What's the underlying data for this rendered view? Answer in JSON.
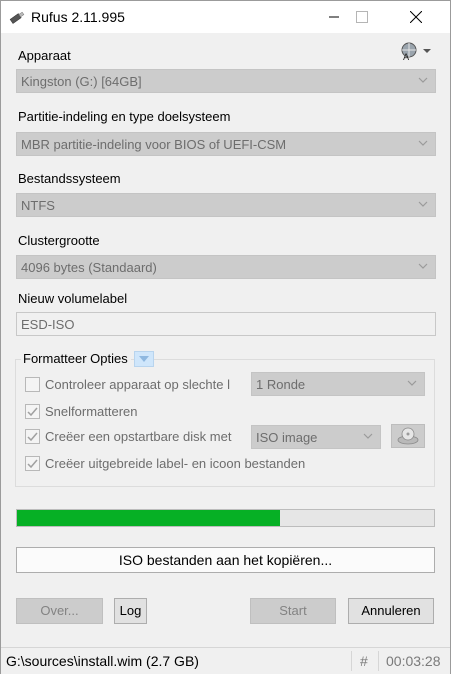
{
  "window": {
    "title": "Rufus 2.11.995"
  },
  "device": {
    "label": "Apparaat",
    "value": "Kingston (G:) [64GB]"
  },
  "partition": {
    "label": "Partitie-indeling en type doelsysteem",
    "value": "MBR partitie-indeling voor BIOS of UEFI-CSM"
  },
  "filesystem": {
    "label": "Bestandssysteem",
    "value": "NTFS"
  },
  "cluster": {
    "label": "Clustergrootte",
    "value": "4096 bytes (Standaard)"
  },
  "volume": {
    "label": "Nieuw volumelabel",
    "value": "ESD-ISO"
  },
  "format_options": {
    "title": "Formatteer Opties",
    "check_bad": {
      "label": "Controleer apparaat op slechte l",
      "checked": false
    },
    "passes": "1 Ronde",
    "quick_format": {
      "label": "Snelformatteren",
      "checked": true
    },
    "bootable": {
      "label": "Creëer een opstartbare disk met",
      "checked": true
    },
    "boot_type": "ISO image",
    "extended_label": {
      "label": "Creëer uitgebreide label- en icoon bestanden",
      "checked": true
    }
  },
  "progress": {
    "fraction": 0.63
  },
  "status_text": "ISO bestanden aan het kopiëren...",
  "buttons": {
    "about": "Over...",
    "log": "Log",
    "start": "Start",
    "cancel": "Annuleren"
  },
  "statusbar": {
    "path": "G:\\sources\\install.wim (2.7 GB)",
    "hash": "#",
    "time": "00:03:28"
  },
  "colors": {
    "progress": "#06b025",
    "disabled_field": "#cccccc"
  },
  "icons": {
    "app": "usb-drive-icon",
    "language": "globe-language-icon",
    "iso": "disc-drive-icon"
  }
}
